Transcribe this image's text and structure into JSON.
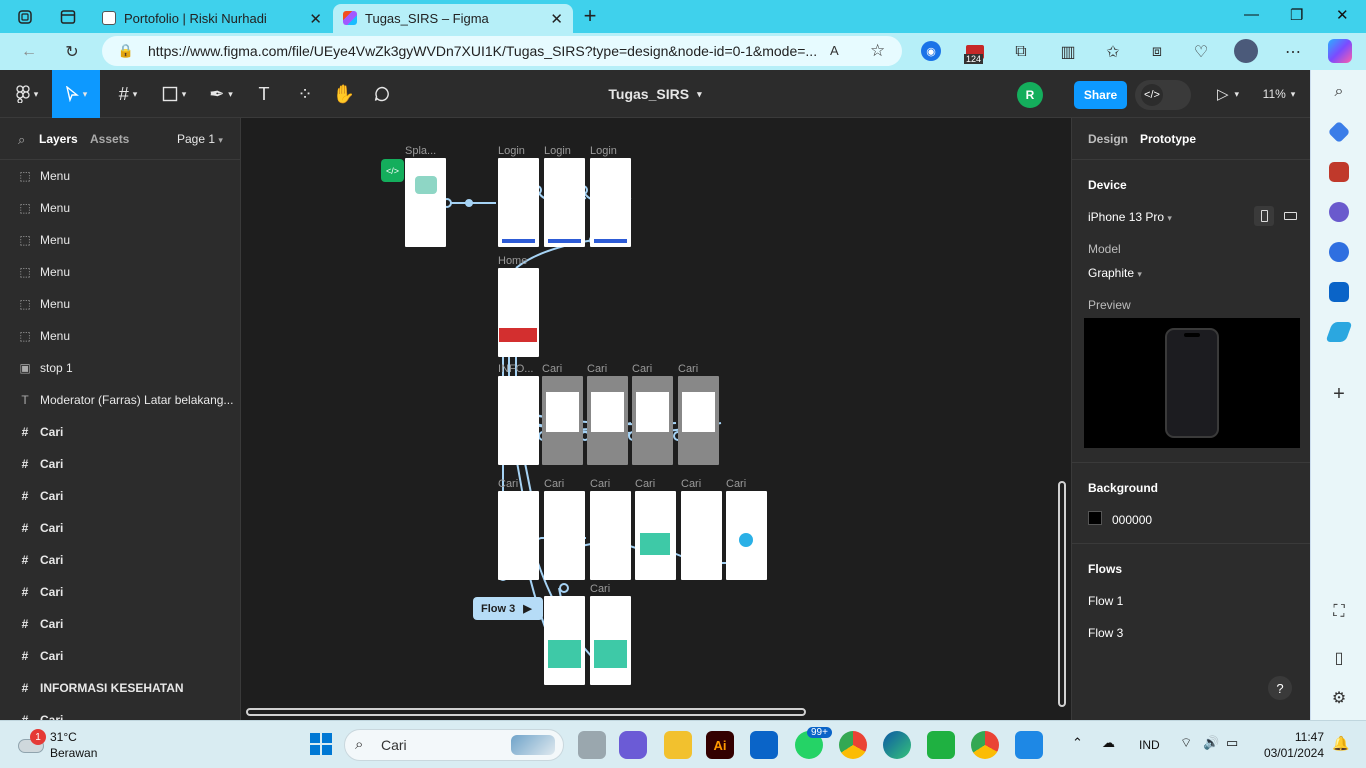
{
  "browser": {
    "tabs": [
      {
        "label": "Portofolio | Riski Nurhadi"
      },
      {
        "label": "Tugas_SIRS – Figma"
      }
    ],
    "url": "https://www.figma.com/file/UEye4VwZk3gyWVDn7XUI1K/Tugas_SIRS?type=design&node-id=0-1&mode=...",
    "badge_count": "124"
  },
  "figma": {
    "file_title": "Tugas_SIRS",
    "avatar_initial": "R",
    "share_label": "Share",
    "zoom": "11%",
    "left_tabs": {
      "layers": "Layers",
      "assets": "Assets",
      "page": "Page 1"
    },
    "layers": [
      {
        "icon": "frame-dashed",
        "label": "Menu"
      },
      {
        "icon": "frame-dashed",
        "label": "Menu"
      },
      {
        "icon": "frame-dashed",
        "label": "Menu"
      },
      {
        "icon": "frame-dashed",
        "label": "Menu"
      },
      {
        "icon": "frame-dashed",
        "label": "Menu"
      },
      {
        "icon": "frame-dashed",
        "label": "Menu"
      },
      {
        "icon": "image",
        "label": "stop 1"
      },
      {
        "icon": "text",
        "label": "Moderator (Farras) Latar belakang..."
      },
      {
        "icon": "hash",
        "label": "Cari"
      },
      {
        "icon": "hash",
        "label": "Cari"
      },
      {
        "icon": "hash",
        "label": "Cari"
      },
      {
        "icon": "hash",
        "label": "Cari"
      },
      {
        "icon": "hash",
        "label": "Cari"
      },
      {
        "icon": "hash",
        "label": "Cari"
      },
      {
        "icon": "hash",
        "label": "Cari"
      },
      {
        "icon": "hash",
        "label": "Cari"
      },
      {
        "icon": "hash",
        "label": "INFORMASI KESEHATAN"
      },
      {
        "icon": "hash",
        "label": "Cari"
      }
    ],
    "canvas_labels": {
      "splash": "Spla...",
      "login1": "Login",
      "login2": "Login",
      "login3": "Login",
      "home": "Home",
      "info": "INFO...",
      "cari": "Cari",
      "flow3": "Flow 3"
    },
    "right": {
      "tabs": {
        "design": "Design",
        "prototype": "Prototype"
      },
      "device_heading": "Device",
      "device": "iPhone 13 Pro",
      "model_heading": "Model",
      "model": "Graphite",
      "preview_heading": "Preview",
      "background_heading": "Background",
      "background_hex": "000000",
      "flows_heading": "Flows",
      "flows": [
        "Flow 1",
        "Flow 3"
      ],
      "help": "?"
    }
  },
  "taskbar": {
    "weather_temp": "31°C",
    "weather_desc": "Berawan",
    "weather_badge": "1",
    "search_placeholder": "Cari",
    "whatsapp_badge": "99+",
    "language": "IND",
    "time": "11:47",
    "date": "03/01/2024"
  },
  "colors": {
    "accent": "#0d99ff",
    "flow_line": "#a6d3f5",
    "avatar_green": "#14ae5c",
    "tabbar": "#3fd1ec"
  }
}
